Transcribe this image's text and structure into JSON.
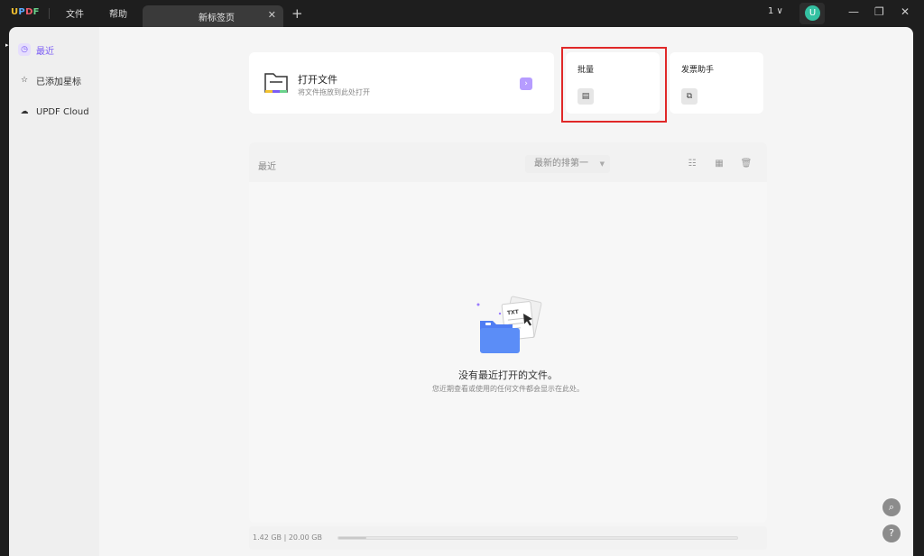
{
  "app": {
    "logo": [
      "U",
      "P",
      "D",
      "F"
    ]
  },
  "menu": {
    "file": "文件",
    "help": "帮助"
  },
  "tabs": [
    {
      "label": "新标签页",
      "close": "✕"
    }
  ],
  "tab_add": "+",
  "page_count": "1 ∨",
  "user_avatar": "U",
  "window_controls": {
    "minimize": "—",
    "restore": "❐",
    "close": "✕"
  },
  "sidebar": {
    "items": [
      {
        "label": "最近",
        "icon": "clock-icon",
        "glyph": "◷",
        "active": true
      },
      {
        "label": "已添加星标",
        "icon": "star-icon",
        "glyph": "☆",
        "active": false
      },
      {
        "label": "UPDF Cloud",
        "icon": "cloud-icon",
        "glyph": "☁",
        "active": false
      }
    ]
  },
  "open_file": {
    "title": "打开文件",
    "subtitle": "将文件拖放到此处打开",
    "arrow": "›"
  },
  "tools": {
    "batch": {
      "title": "批量",
      "glyph": "▤"
    },
    "invoice": {
      "title": "发票助手",
      "glyph": "⧉"
    }
  },
  "recent": {
    "title": "最近",
    "sort_label": "最新的排第一",
    "sort_chevron": "▼",
    "icons": {
      "list": "☷",
      "grid": "▦",
      "trash": "🗑"
    },
    "empty_title": "没有最近打开的文件。",
    "empty_subtitle": "您近期查看或使用的任何文件都会显示在此处。",
    "art_label": "TXT"
  },
  "storage": {
    "text": "1.42 GB | 20.00 GB",
    "used_fraction": 0.071
  },
  "corner_buttons": {
    "search": "⌕",
    "help": "?"
  },
  "colors": {
    "accent": "#7b5cf5",
    "highlight": "#e02828",
    "avatar": "#34c1a2"
  }
}
